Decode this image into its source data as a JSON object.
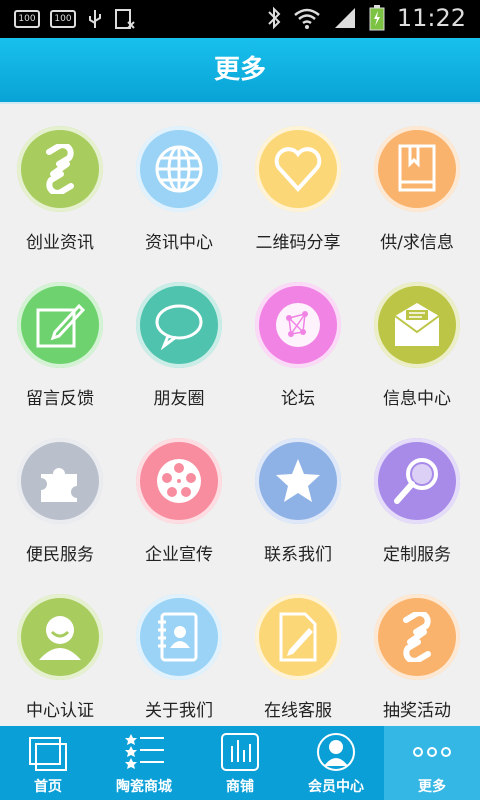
{
  "status": {
    "time": "11:22",
    "badge1": "100",
    "badge2": "100"
  },
  "title": "更多",
  "items": [
    {
      "label": "创业资讯",
      "color": "#a9cc5e",
      "icon": "link-icon"
    },
    {
      "label": "资讯中心",
      "color": "#9ad3f5",
      "icon": "globe-icon"
    },
    {
      "label": "二维码分享",
      "color": "#fbd777",
      "icon": "heart-icon"
    },
    {
      "label": "供/求信息",
      "color": "#f9b36c",
      "icon": "book-icon"
    },
    {
      "label": "留言反馈",
      "color": "#6ed36e",
      "icon": "edit-icon"
    },
    {
      "label": "朋友圈",
      "color": "#4fc3ae",
      "icon": "chat-bubble-icon"
    },
    {
      "label": "论坛",
      "color": "#f083e4",
      "icon": "network-icon"
    },
    {
      "label": "信息中心",
      "color": "#bcc545",
      "icon": "mail-icon"
    },
    {
      "label": "便民服务",
      "color": "#b9c0cc",
      "icon": "puzzle-icon"
    },
    {
      "label": "企业宣传",
      "color": "#f78d9e",
      "icon": "film-reel-icon"
    },
    {
      "label": "联系我们",
      "color": "#8fb2e6",
      "icon": "star-icon"
    },
    {
      "label": "定制服务",
      "color": "#a88be9",
      "icon": "magnifier-icon"
    },
    {
      "label": "中心认证",
      "color": "#a9cc5e",
      "icon": "user-icon"
    },
    {
      "label": "关于我们",
      "color": "#9ad3f5",
      "icon": "contacts-icon"
    },
    {
      "label": "在线客服",
      "color": "#fbd777",
      "icon": "document-pen-icon"
    },
    {
      "label": "抽奖活动",
      "color": "#f9b36c",
      "icon": "link-icon"
    }
  ],
  "tabs": [
    {
      "label": "首页",
      "icon": "home-icon"
    },
    {
      "label": "陶瓷商城",
      "icon": "list-icon"
    },
    {
      "label": "商铺",
      "icon": "shop-icon"
    },
    {
      "label": "会员中心",
      "icon": "member-icon"
    },
    {
      "label": "更多",
      "icon": "more-icon"
    }
  ]
}
